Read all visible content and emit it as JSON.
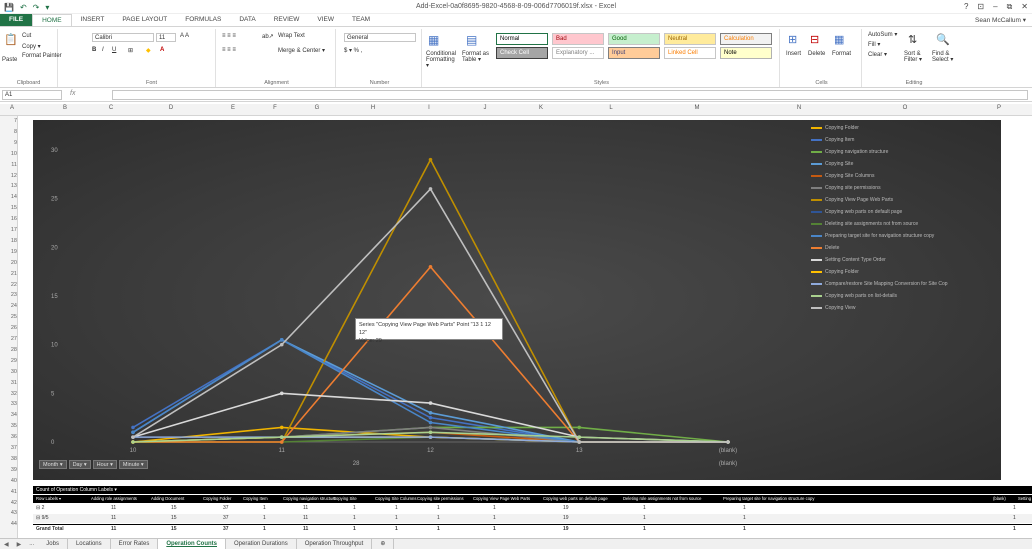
{
  "window": {
    "title": "Add-Excel-0a0f8695-9820-4568-8-09-006d7706019f.xlsx - Excel",
    "qat": [
      "💾",
      "↶",
      "↷",
      "▾"
    ],
    "controls": [
      "?",
      "⊡",
      "–",
      "⧉",
      "✕"
    ]
  },
  "ribbon_tabs": [
    "FILE",
    "HOME",
    "INSERT",
    "PAGE LAYOUT",
    "FORMULAS",
    "DATA",
    "REVIEW",
    "VIEW",
    "TEAM"
  ],
  "user": "Sean McCallum ▾",
  "clipboard": {
    "cut": "Cut",
    "copy": "Copy ▾",
    "paste": "Paste",
    "format_painter": "Format Painter",
    "label": "Clipboard"
  },
  "font": {
    "name": "Calibri",
    "size": "11",
    "label": "Font"
  },
  "alignment": {
    "wrap": "Wrap Text",
    "merge": "Merge & Center ▾",
    "label": "Alignment"
  },
  "number": {
    "format": "General",
    "label": "Number",
    "currency": "$ ▾ % ,"
  },
  "styles": {
    "conditional": "Conditional Formatting ▾",
    "format_table": "Format as Table ▾",
    "label": "Styles",
    "cells": [
      {
        "text": "Normal",
        "bg": "#ffffff",
        "fg": "#000000",
        "border": "#217346"
      },
      {
        "text": "Bad",
        "bg": "#ffc7ce",
        "fg": "#9c0006",
        "border": "#c6c6c6"
      },
      {
        "text": "Good",
        "bg": "#c6efce",
        "fg": "#006100",
        "border": "#c6c6c6"
      },
      {
        "text": "Neutral",
        "bg": "#ffeb9c",
        "fg": "#9c6500",
        "border": "#c6c6c6"
      },
      {
        "text": "Calculation",
        "bg": "#f2f2f2",
        "fg": "#fa7d00",
        "border": "#7f7f7f"
      },
      {
        "text": "Check Cell",
        "bg": "#a5a5a5",
        "fg": "#ffffff",
        "border": "#3f3f3f"
      },
      {
        "text": "Explanatory ...",
        "bg": "#ffffff",
        "fg": "#7f7f7f",
        "border": "#c6c6c6"
      },
      {
        "text": "Input",
        "bg": "#ffcc99",
        "fg": "#3f3f76",
        "border": "#7f7f7f"
      },
      {
        "text": "Linked Cell",
        "bg": "#ffffff",
        "fg": "#fa7d00",
        "border": "#c6c6c6"
      },
      {
        "text": "Note",
        "bg": "#ffffcc",
        "fg": "#000000",
        "border": "#b2b2b2"
      }
    ]
  },
  "cells_group": {
    "insert": "Insert",
    "delete": "Delete",
    "format": "Format",
    "label": "Cells"
  },
  "editing": {
    "autosum": "AutoSum ▾",
    "fill": "Fill ▾",
    "clear": "Clear ▾",
    "sort": "Sort & Filter ▾",
    "find": "Find & Select ▾",
    "label": "Editing"
  },
  "formula_bar": {
    "name_box": "A1",
    "fx": "fx"
  },
  "col_headers": [
    "A",
    "B",
    "C",
    "D",
    "E",
    "F",
    "G",
    "H",
    "I",
    "J",
    "K",
    "L",
    "M",
    "N",
    "O",
    "P"
  ],
  "row_headers": [
    "7",
    "8",
    "9",
    "10",
    "11",
    "12",
    "13",
    "14",
    "15",
    "16",
    "17",
    "18",
    "19",
    "20",
    "21",
    "22",
    "23",
    "24",
    "25",
    "26",
    "27",
    "28",
    "29",
    "30",
    "31",
    "32",
    "33",
    "34",
    "35",
    "36",
    "37",
    "38",
    "39",
    "40",
    "41",
    "42",
    "43",
    "44"
  ],
  "chart_data": {
    "type": "line",
    "x": [
      "10",
      "11",
      "12",
      "13",
      "(blank)"
    ],
    "x_group_labels": [
      "28",
      "(blank)"
    ],
    "y_ticks": [
      "0",
      "5",
      "10",
      "15",
      "20",
      "25",
      "30"
    ],
    "ylim": [
      0,
      30
    ],
    "grid": false,
    "legend_position": "right",
    "series": [
      {
        "name": "Copying Folder",
        "color": "#f0b400",
        "values": [
          0,
          1.5,
          0.5,
          0,
          0
        ]
      },
      {
        "name": "Copying Item",
        "color": "#4472c4",
        "values": [
          1.5,
          10.5,
          2.5,
          0,
          0
        ]
      },
      {
        "name": "Copying navigation structure",
        "color": "#70ad47",
        "values": [
          0,
          0.5,
          1.5,
          1.5,
          0
        ]
      },
      {
        "name": "Copying Site",
        "color": "#5b9bd5",
        "values": [
          1,
          10.5,
          3,
          0,
          0
        ]
      },
      {
        "name": "Copying Site Columns",
        "color": "#c55a11",
        "values": [
          0,
          0.5,
          1,
          0,
          0
        ]
      },
      {
        "name": "Copying site permissions",
        "color": "#7f7f7f",
        "values": [
          0,
          0.5,
          1.5,
          0,
          0
        ]
      },
      {
        "name": "Copying View Page Web Parts",
        "color": "#bf8f00",
        "values": [
          0,
          0,
          29,
          0,
          0
        ]
      },
      {
        "name": "Copying web parts on default page",
        "color": "#2f5597",
        "values": [
          0,
          0.5,
          0.5,
          0,
          0
        ]
      },
      {
        "name": "Deleting site assignments not from source",
        "color": "#548235",
        "values": [
          0,
          0,
          0.5,
          0,
          0
        ]
      },
      {
        "name": "Preparing target site for navigation structure copy",
        "color": "#4a86c8",
        "values": [
          1,
          10.5,
          2,
          0,
          0
        ]
      },
      {
        "name": "Delete",
        "color": "#ed7d31",
        "values": [
          0,
          0,
          18,
          0,
          0
        ]
      },
      {
        "name": "Setting Content Type Order",
        "color": "#d9d9d9",
        "values": [
          0.5,
          5,
          4,
          0.5,
          0
        ]
      },
      {
        "name": "Copying Folder",
        "color": "#ffc000",
        "values": [
          0,
          0.5,
          0.5,
          0,
          0
        ]
      },
      {
        "name": "Compare/restore Site Mapping Conversion for Site Cop",
        "color": "#8faadc",
        "values": [
          0.5,
          0.5,
          0.5,
          0,
          0
        ]
      },
      {
        "name": "Copying web parts on list-details",
        "color": "#a9d18e",
        "values": [
          0,
          0.5,
          1,
          0.5,
          0
        ]
      },
      {
        "name": "Copying View",
        "color": "#bfbfbf",
        "values": [
          0.5,
          10,
          26,
          0,
          0
        ]
      }
    ],
    "tooltip": {
      "line1": "Series \"Copying View Page Web Parts\" Point \"13 1 12 12\"",
      "line2": "Value: 29"
    },
    "field_buttons": [
      "Month ▾",
      "Day ▾",
      "Hour ▾",
      "Minute ▾"
    ]
  },
  "pivot": {
    "header": "Count of Operation   Column Labels ▾",
    "columns": [
      "Row Labels ▾",
      "Adding role assignments",
      "Adding Document",
      "Copying Folder",
      "Copying Item",
      "Copying navigation structure",
      "Copying Site",
      "Copying Site Columns",
      "Copying site permissions",
      "Copying View Page Web Parts",
      "Copying web parts on default page",
      "Deleting role assignments not from source",
      "Preparing target site for navigation structure copy",
      "(blank)",
      "Setting"
    ],
    "rows": [
      {
        "label": "⊟ 2",
        "vals": [
          "11",
          "15",
          "37",
          "1",
          "11",
          "1",
          "1",
          "1",
          "1",
          "19",
          "1",
          "1",
          "1",
          "1"
        ]
      },
      {
        "label": "  ⊟ 9/5",
        "vals": [
          "11",
          "15",
          "37",
          "1",
          "11",
          "1",
          "1",
          "1",
          "1",
          "19",
          "1",
          "1",
          "1",
          "1"
        ]
      },
      {
        "label": "Grand Total",
        "vals": [
          "11",
          "15",
          "37",
          "1",
          "11",
          "1",
          "1",
          "1",
          "1",
          "19",
          "1",
          "1",
          "1",
          "1"
        ]
      }
    ]
  },
  "sheet_tabs": [
    "Jobs",
    "Locations",
    "Error Rates",
    "Operation Counts",
    "Operation Durations",
    "Operation Throughput",
    "⊕"
  ],
  "active_sheet": "Operation Counts",
  "sheet_nav": [
    "◀",
    "▶",
    "..."
  ]
}
